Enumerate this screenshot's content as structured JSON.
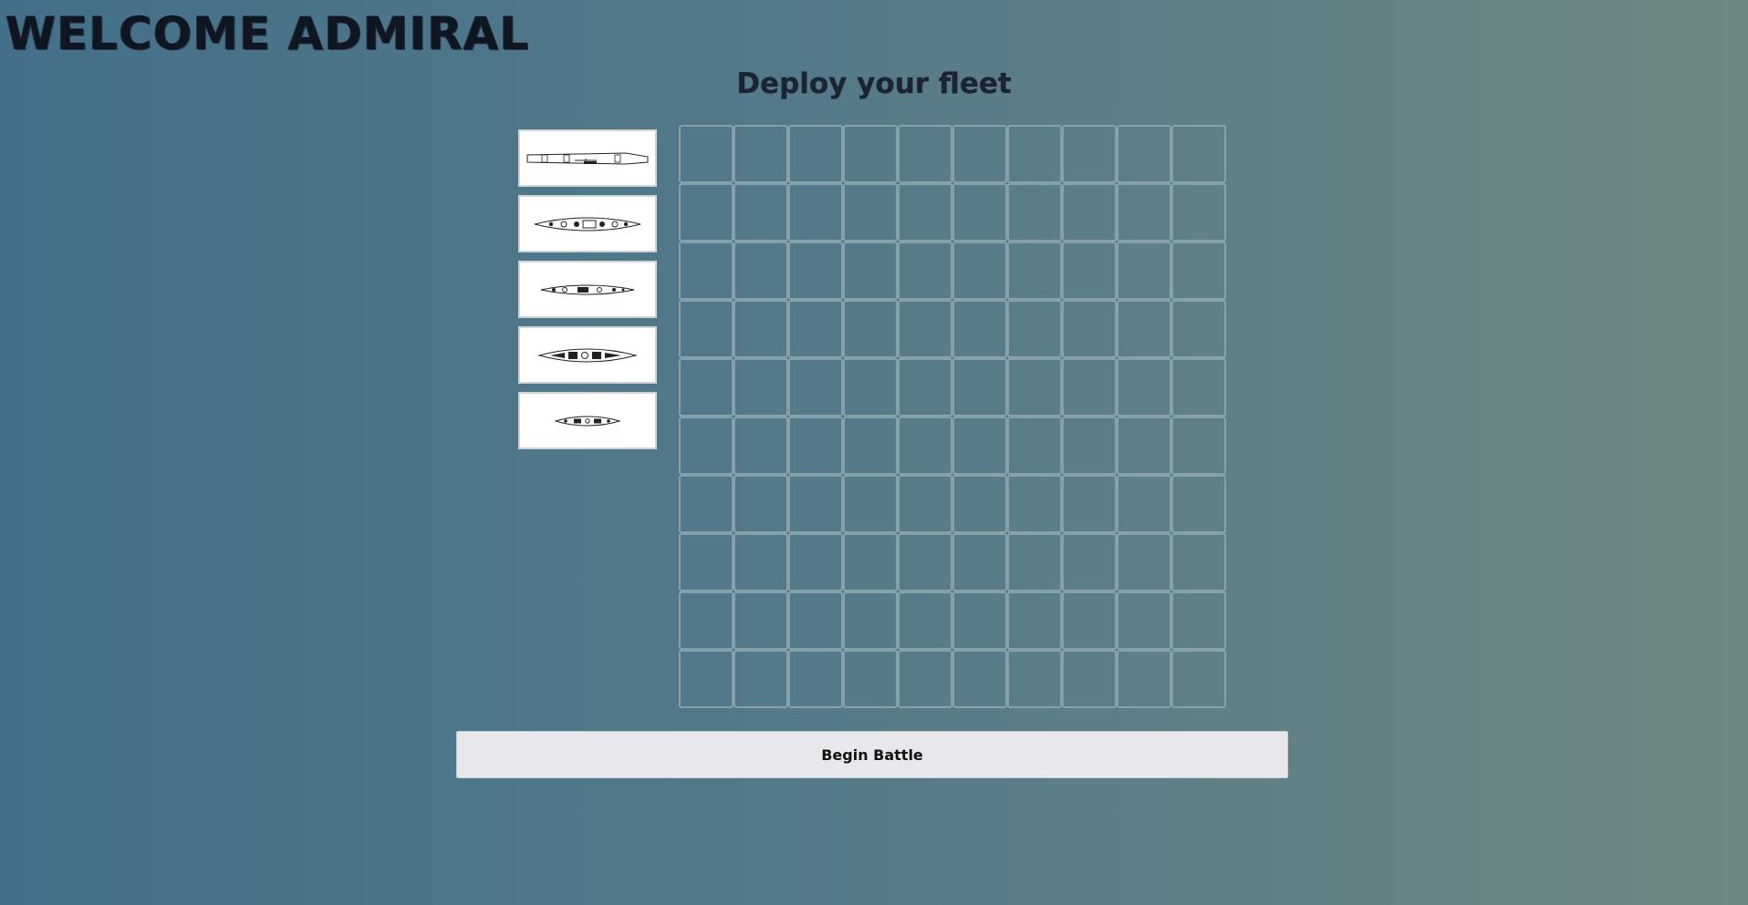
{
  "header": {
    "title": "WELCOME ADMIRAL",
    "subtitle": "Deploy your fleet"
  },
  "fleet": {
    "ships": [
      {
        "id": "carrier",
        "icon": "aircraft-carrier-icon"
      },
      {
        "id": "battleship",
        "icon": "battleship-icon"
      },
      {
        "id": "cruiser",
        "icon": "cruiser-icon"
      },
      {
        "id": "submarine",
        "icon": "submarine-icon"
      },
      {
        "id": "destroyer",
        "icon": "destroyer-icon"
      }
    ]
  },
  "board": {
    "rows": 10,
    "columns": 10
  },
  "actions": {
    "begin_label": "Begin Battle"
  },
  "colors": {
    "background_start": "#42708a",
    "background_end": "#6f8783",
    "cell_border": "#86a1aa",
    "button_bg": "#e8e8ec"
  }
}
